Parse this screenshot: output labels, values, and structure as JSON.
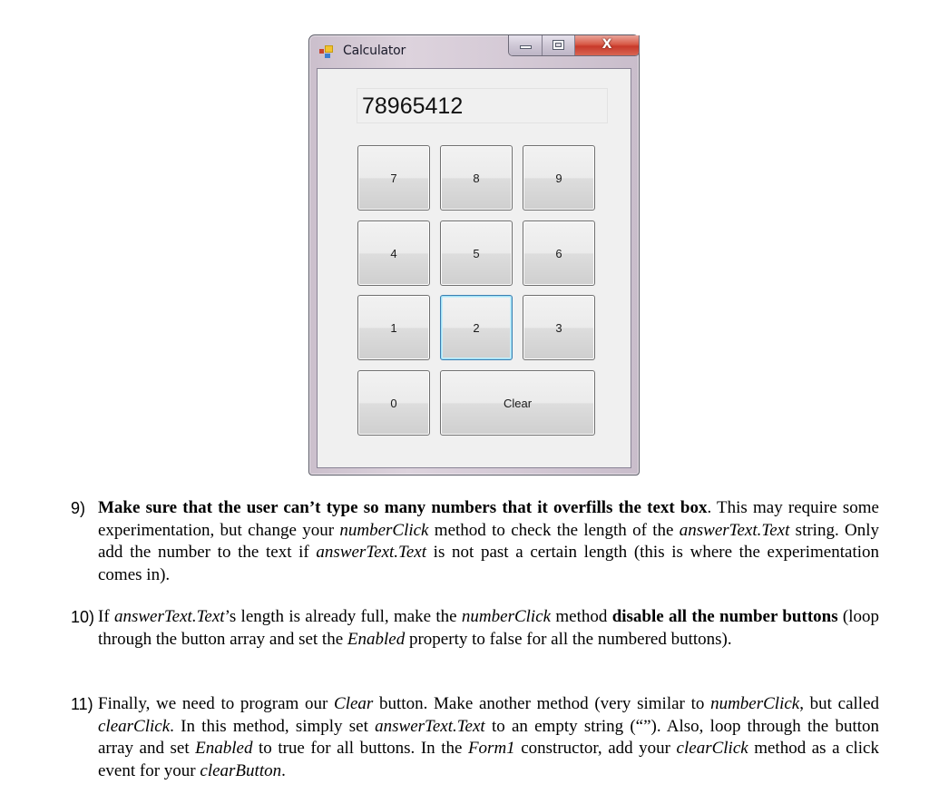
{
  "window": {
    "title": "Calculator",
    "icon": "app-form-icon",
    "caption_buttons": {
      "minimize": "minimize-icon",
      "maximize": "maximize-icon",
      "close": "close-icon",
      "close_glyph": "X"
    },
    "answer_text": "78965412",
    "buttons": [
      {
        "label": "7",
        "focused": false
      },
      {
        "label": "8",
        "focused": false
      },
      {
        "label": "9",
        "focused": false
      },
      {
        "label": "4",
        "focused": false
      },
      {
        "label": "5",
        "focused": false
      },
      {
        "label": "6",
        "focused": false
      },
      {
        "label": "1",
        "focused": false
      },
      {
        "label": "2",
        "focused": true
      },
      {
        "label": "3",
        "focused": false
      },
      {
        "label": "0",
        "focused": false
      },
      {
        "label": "Clear",
        "focused": false
      }
    ]
  },
  "document": {
    "items": [
      {
        "number": "9)",
        "segments": [
          {
            "t": "Make sure that the user can’t type so many numbers that it overfills the text box",
            "style": "bold"
          },
          {
            "t": ".  This may require some experimentation, but change your ",
            "style": "normal"
          },
          {
            "t": "numberClick",
            "style": "italic"
          },
          {
            "t": " method to check the length of the ",
            "style": "normal"
          },
          {
            "t": "answerText.Text",
            "style": "italic"
          },
          {
            "t": " string.  Only add the number to the text if ",
            "style": "normal"
          },
          {
            "t": "answerText.Text",
            "style": "italic"
          },
          {
            "t": " is not past a certain length (this is where the experimentation comes in).",
            "style": "normal"
          }
        ]
      },
      {
        "number": "10)",
        "segments": [
          {
            "t": "If ",
            "style": "normal"
          },
          {
            "t": "answerText.Text",
            "style": "italic"
          },
          {
            "t": "’s length is already full, make the ",
            "style": "normal"
          },
          {
            "t": "numberClick",
            "style": "italic"
          },
          {
            "t": " method ",
            "style": "normal"
          },
          {
            "t": "disable all the number buttons",
            "style": "bold"
          },
          {
            "t": " (loop through the button array and set the ",
            "style": "normal"
          },
          {
            "t": "Enabled",
            "style": "italic"
          },
          {
            "t": " property to false for all the numbered buttons).",
            "style": "normal"
          }
        ]
      },
      {
        "number": "11)",
        "segments": [
          {
            "t": "Finally, we need to program our ",
            "style": "normal"
          },
          {
            "t": "Clear",
            "style": "italic"
          },
          {
            "t": " button.  Make another method (very similar to ",
            "style": "normal"
          },
          {
            "t": "numberClick",
            "style": "italic"
          },
          {
            "t": ", but called ",
            "style": "normal"
          },
          {
            "t": "clearClick",
            "style": "italic"
          },
          {
            "t": ". In this method, simply set ",
            "style": "normal"
          },
          {
            "t": "answerText.Text",
            "style": "italic"
          },
          {
            "t": " to an empty string (“”).  Also, loop through the button array and set ",
            "style": "normal"
          },
          {
            "t": "Enabled",
            "style": "italic"
          },
          {
            "t": " to true for all buttons. In the ",
            "style": "normal"
          },
          {
            "t": "Form1",
            "style": "italic"
          },
          {
            "t": " constructor, add your ",
            "style": "normal"
          },
          {
            "t": "clearClick",
            "style": "italic"
          },
          {
            "t": " method as a click event for your ",
            "style": "normal"
          },
          {
            "t": "clearButton",
            "style": "italic"
          },
          {
            "t": ".",
            "style": "normal"
          }
        ]
      }
    ]
  }
}
